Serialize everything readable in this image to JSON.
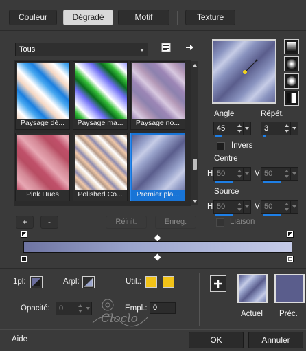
{
  "tabs": [
    {
      "label": "Couleur"
    },
    {
      "label": "Dégradé"
    },
    {
      "label": "Motif"
    },
    {
      "label": "Texture"
    }
  ],
  "category_select": {
    "value": "Tous"
  },
  "gradients": [
    {
      "label": "Paysage dé..."
    },
    {
      "label": "Paysage ma..."
    },
    {
      "label": "Paysage no..."
    },
    {
      "label": "Pink Hues"
    },
    {
      "label": "Polished Co..."
    },
    {
      "label": "Premier pla..."
    }
  ],
  "buttons": {
    "add": "+",
    "remove": "-",
    "reset": "Réinit.",
    "save": "Enreg.",
    "ok": "OK",
    "cancel": "Annuler",
    "help": "Aide"
  },
  "angle": {
    "label": "Angle",
    "value": "45"
  },
  "repeat": {
    "label": "Répét.",
    "value": "3"
  },
  "invert": {
    "label": "Invers"
  },
  "center": {
    "label": "Centre",
    "h_label": "H",
    "h_value": "50",
    "v_label": "V",
    "v_value": "50"
  },
  "source": {
    "label": "Source",
    "h_label": "H",
    "h_value": "50",
    "v_label": "V",
    "v_value": "50"
  },
  "link": {
    "label": "Liaison"
  },
  "bottom": {
    "first_plane_label": "1pl:",
    "background_label": "Arpl:",
    "use_label": "Util.:",
    "opacity_label": "Opacité:",
    "opacity_value": "0",
    "location_label": "Empl.:",
    "location_value": "0",
    "current_label": "Actuel",
    "previous_label": "Préc.",
    "watermark_text": "Cloclo"
  },
  "colors": {
    "accent": "#1e7fe6",
    "gradient_start": "#9aa4cc",
    "gradient_end": "#5a5d8c",
    "use_color": "#f2c318"
  }
}
